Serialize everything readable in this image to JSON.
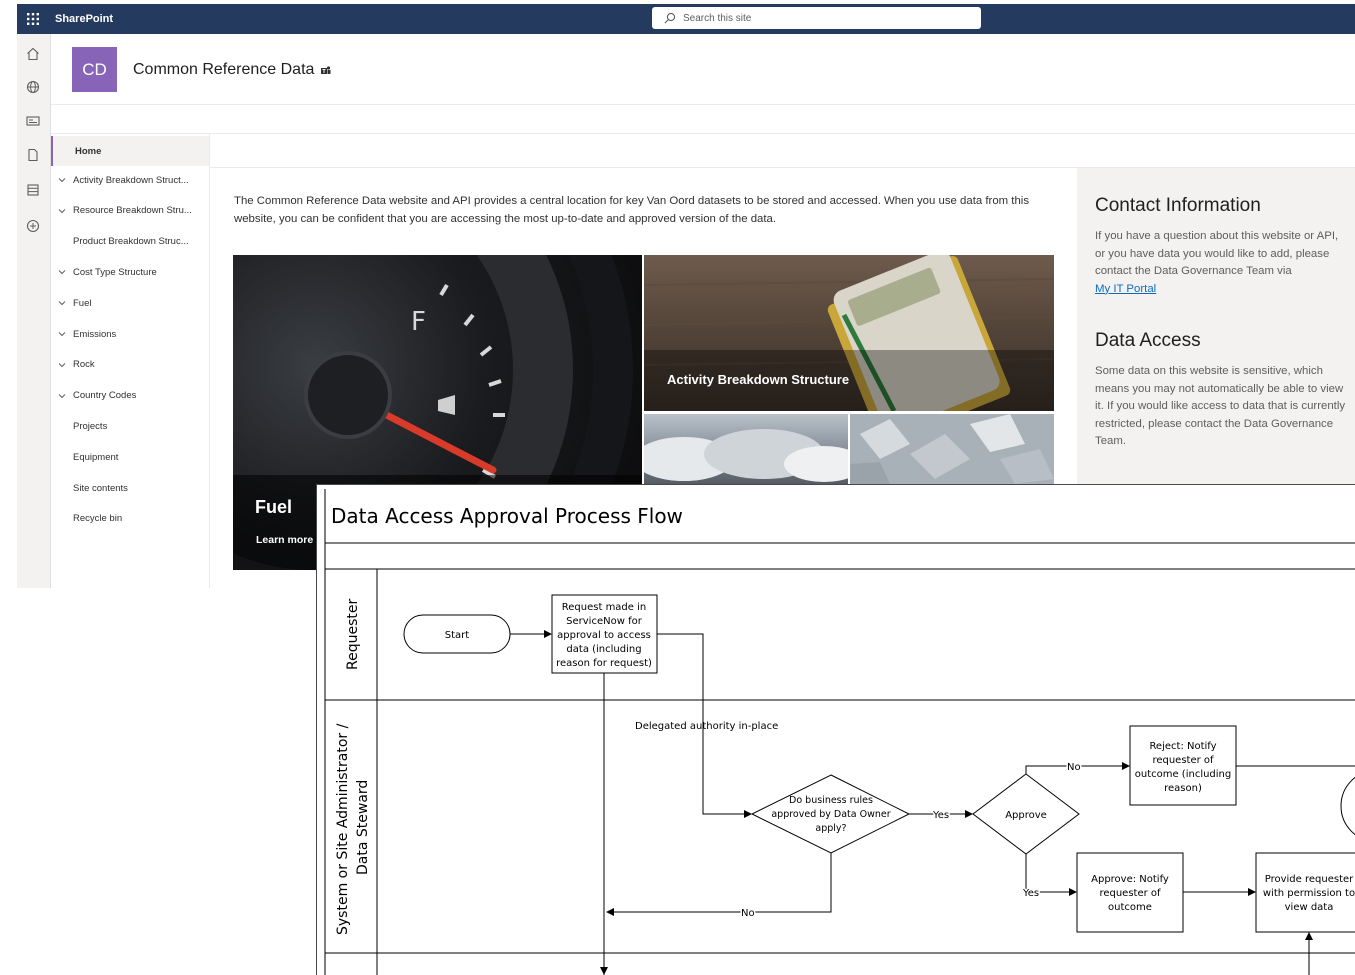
{
  "suite_bar": {
    "brand": "SharePoint",
    "search_placeholder": "Search this site"
  },
  "app_bar": {
    "icons": [
      "home-icon",
      "globe-icon",
      "news-icon",
      "document-icon",
      "list-icon",
      "add-icon"
    ]
  },
  "site": {
    "logo_initials": "CD",
    "logo_color": "#8764b8",
    "title": "Common Reference Data"
  },
  "quick_launch": {
    "items": [
      {
        "label": "Home",
        "expandable": false,
        "active": true
      },
      {
        "label": "Activity Breakdown Struct...",
        "expandable": true
      },
      {
        "label": "Resource Breakdown Stru...",
        "expandable": true
      },
      {
        "label": "Product Breakdown Struc...",
        "expandable": false
      },
      {
        "label": "Cost Type Structure",
        "expandable": true
      },
      {
        "label": "Fuel",
        "expandable": true
      },
      {
        "label": "Emissions",
        "expandable": true
      },
      {
        "label": "Rock",
        "expandable": true
      },
      {
        "label": "Country Codes",
        "expandable": true
      },
      {
        "label": "Projects",
        "expandable": false
      },
      {
        "label": "Equipment",
        "expandable": false
      },
      {
        "label": "Site contents",
        "expandable": false
      },
      {
        "label": "Recycle bin",
        "expandable": false
      }
    ]
  },
  "main": {
    "intro": "The Common Reference Data website and API provides a central location for key Van Oord datasets to be stored and accessed. When you use data from this website, you can be confident that you are accessing the most up-to-date and approved version of the data.",
    "tiles": {
      "fuel_title": "Fuel",
      "fuel_link": "Learn more",
      "abs_title": "Activity Breakdown Structure"
    }
  },
  "right_pane": {
    "contact_heading": "Contact Information",
    "contact_text": "If you have a question about this website or API, or you have data you would like to add, please contact the Data Governance Team via",
    "contact_link": "My IT Portal",
    "access_heading": "Data Access",
    "access_text": "Some data on this website is sensitive, which means you may not automatically be able to view it. If you would like access to data that is currently restricted, please contact the Data Governance Team."
  },
  "diagram": {
    "title": "Data Access Approval Process Flow",
    "lane_requester": "Requester",
    "lane_admin_line1": "System or Site Administrator /",
    "lane_admin_line2": "Data Steward",
    "start": "Start",
    "request_box": [
      "Request made in",
      "ServiceNow for",
      "approval to access",
      "data (including",
      "reason for request)"
    ],
    "delegated": "Delegated authority in-place",
    "decision_rules": [
      "Do business rules",
      "approved by Data Owner",
      "apply?"
    ],
    "decision_approve": "Approve",
    "reject_box": [
      "Reject: Notify",
      "requester of",
      "outcome (including",
      "reason)"
    ],
    "approve_box": [
      "Approve: Notify",
      "requester of",
      "outcome"
    ],
    "provide_box": [
      "Provide requester",
      "with permission to",
      "view data"
    ],
    "yes": "Yes",
    "no": "No"
  }
}
